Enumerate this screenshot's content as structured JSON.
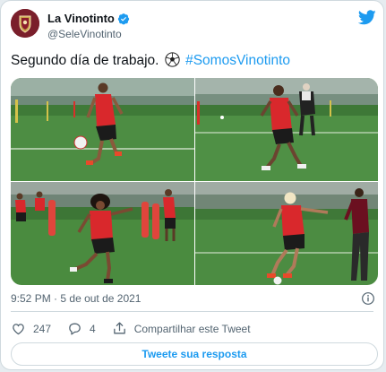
{
  "account": {
    "display_name": "La Vinotinto",
    "handle": "@SeleVinotinto",
    "avatar_icon": "crest-icon",
    "verified_icon": "verified-badge-icon"
  },
  "tweet": {
    "text_before": "Segundo día de trabajo.",
    "emoji_icon": "soccer-ball-icon",
    "hashtag": "#SomosVinotinto"
  },
  "media": {
    "photos": [
      {
        "alt": "player-juggling-ball"
      },
      {
        "alt": "player-running"
      },
      {
        "alt": "player-kicking-long-hair"
      },
      {
        "alt": "player-kicking-blond"
      }
    ]
  },
  "meta": {
    "time": "9:52 PM",
    "separator": "·",
    "date": "5 de out de 2021"
  },
  "actions": {
    "likes_count": "247",
    "replies_count": "4",
    "share_label": "Compartilhar este Tweet"
  },
  "reply": {
    "label": "Tweete sua resposta"
  },
  "colors": {
    "accent": "#1d9bf0",
    "brand": "#7a1f2b",
    "like": "#f91880"
  }
}
